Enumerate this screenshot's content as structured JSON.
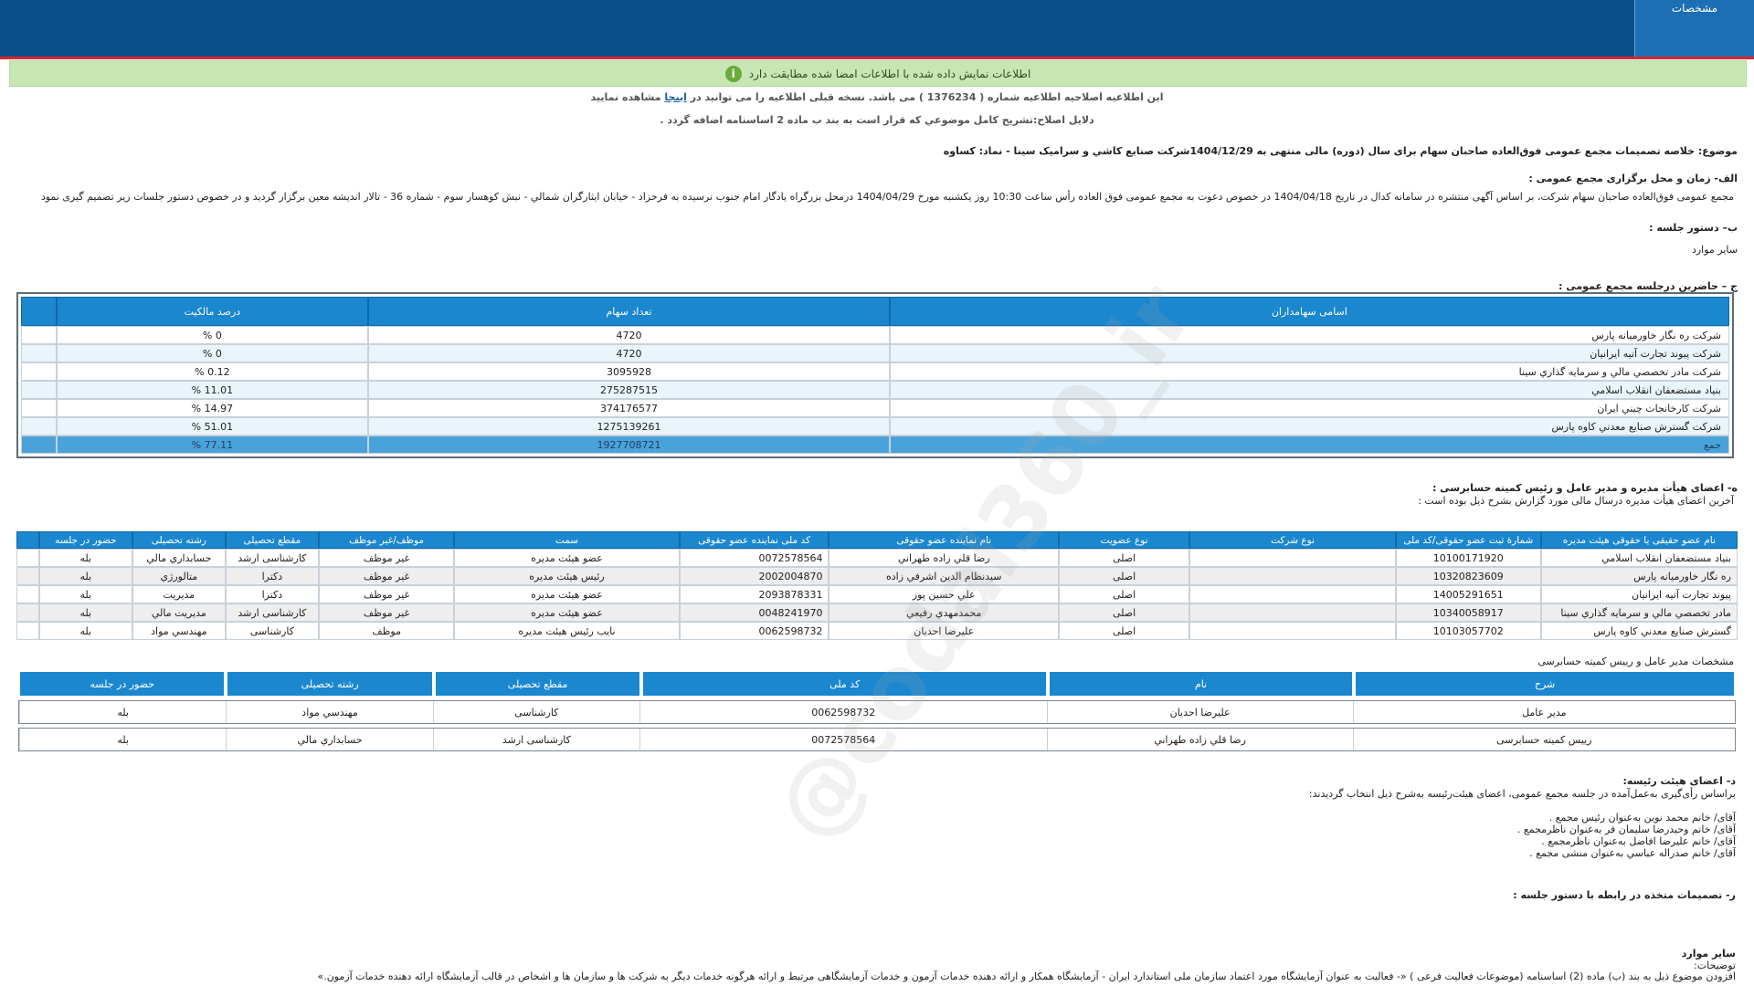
{
  "header": {
    "tab_label": "مشخصات"
  },
  "alert": {
    "text": "اطلاعات نمایش داده شده با اطلاعات امضا شده مطابقت دارد"
  },
  "correction": {
    "line1_a": "این اطلاعیه اصلاحیه اطلاعیه شماره ( 1376234 ) می باشد. نسخه قبلی اطلاعیه را می توانید در",
    "line1_link": "اینجا",
    "line1_b": "مشاهده نمایید",
    "line2": "دلایل اصلاح:تشریح کامل موضوعي که قرار است به بند ب ماده 2 اساسنامه اضافه گردد ."
  },
  "subject": "موضوع: خلاصه تصمیمات مجمع عمومی فوق‌العاده صاحبان سهام برای سال (دوره) مالی منتهی به 1404/12/29شرکت صنايع کاشي و سراميک سينا - نماد: کساوه",
  "section_a": {
    "title": "الف- زمان و محل برگزاری مجمع عمومی :",
    "text": "مجمع عمومی فوق‌العاده صاحبان سهام شرکت، بر اساس آگهی منتشره در سامانه کدال در تاریخ 1404/04/18 در خصوص دعوت به مجمع عمومی فوق العاده رأس ساعت 10:30 روز یکشنبه مورخ 1404/04/29 درمحل بزرگراه يادگار امام جنوب نرسيده به فرحزاد - خيابان ايثارگران شمالي - نبش کوهسار سوم - شماره 36 - تالار انديشه معين   برگزار گردید و در خصوص دستور جلسات زیر تصمیم گیری نمود"
  },
  "section_b": {
    "title": "ب– دستور جلسه :",
    "text": "سایر موارد"
  },
  "section_c": {
    "title": "ج – حاضرین درجلسه مجمع عمومی :",
    "headers": [
      "اسامی سهامداران",
      "تعداد سهام",
      "درصد مالکیت"
    ],
    "rows": [
      [
        "شرکت ره نگار خاورمیانه پارس",
        "4720",
        "0 %"
      ],
      [
        "شرکت پیوند تجارت آتیه ایرانیان",
        "4720",
        "0 %"
      ],
      [
        "شرکت مادر تخصصي مالي و سرمايه گذاري سينا",
        "3095928",
        "0.12 %"
      ],
      [
        "بنياد مستضعفان انقلاب اسلامي",
        "275287515",
        "11.01 %"
      ],
      [
        "شرکت کارخانجات چيني ايران",
        "374176577",
        "14.97 %"
      ],
      [
        "شرکت گسترش صنايع معدني کاوه پارس",
        "1275139261",
        "51.01 %"
      ],
      [
        "جمع",
        "1927708721",
        "77.11 %"
      ]
    ]
  },
  "section_h": {
    "title": "ه- اعضای هیأت مدیره و مدیر عامل و رئیس کمیته حسابرسی :",
    "subtitle": "آخرین اعضای هیأت مدیره درسال مالی مورد گزارش بشرح ذیل بوده است :",
    "headers": [
      "نام عضو حقیقی یا حقوقی هیئت مدیره",
      "شمارهٔ ثبت عضو حقوقی/کد ملی",
      "نوع شرکت",
      "نوع عضویت",
      "نام نماینده عضو حقوقی",
      "کد ملی نماینده عضو حقوقی",
      "سمت",
      "موظف/غیر موظف",
      "مقطع تحصیلی",
      "رشته تحصیلی",
      "حضور در جلسه"
    ],
    "rows": [
      [
        "بنياد مستضعفان انقلاب اسلامي",
        "10100171920",
        "",
        "اصلی",
        "رضا قلي زاده طهراني",
        "0072578564",
        "عضو هیئت مدیره",
        "غیر موظف",
        "کارشناسی ارشد",
        "حسابداري مالي",
        "بله"
      ],
      [
        "ره نگار خاورميانه پارس",
        "10320823609",
        "",
        "اصلی",
        "سيدنظام الدين اشرفي زاده",
        "2002004870",
        "رئیس هیئت مدیره",
        "غیر موظف",
        "دکترا",
        "متالورژي",
        "بله"
      ],
      [
        "پيوند تجارت آتيه ايرانيان",
        "14005291651",
        "",
        "اصلی",
        "علي حسين پور",
        "2093878331",
        "عضو هیئت مدیره",
        "غیر موظف",
        "دکترا",
        "مديريت",
        "بله"
      ],
      [
        "مادر تخصصي مالي و سرمايه گذاري سينا",
        "10340058917",
        "",
        "اصلی",
        "محمدمهدي رفيعي",
        "0048241970",
        "عضو هیئت مدیره",
        "غیر موظف",
        "کارشناسی ارشد",
        "مديريت مالي",
        "بله"
      ],
      [
        "گسترش صنايع معدني کاوه پارس",
        "10103057702",
        "",
        "اصلی",
        "عليرضا احديان",
        "0062598732",
        "نایب رئیس هیئت مدیره",
        "موظف",
        "کارشناسی",
        "مهندسي مواد",
        "بله"
      ]
    ]
  },
  "managers": {
    "title": "مشخصات مدیر عامل و رییس کمیته حسابرسی",
    "headers": [
      "شرح",
      "نام",
      "کد ملی",
      "مقطع تحصیلی",
      "رشته تحصیلی",
      "حضور در جلسه"
    ],
    "rows": [
      [
        "مدیر عامل",
        "عليرضا احديان",
        "0062598732",
        "کارشناسی",
        "مهندسي مواد",
        "بله"
      ],
      [
        "رییس کمیته حسابرسی",
        "رضا قلي زاده طهراني",
        "0072578564",
        "کارشناسی ارشد",
        "حسابداري مالي",
        "بله"
      ]
    ]
  },
  "section_d": {
    "title": "د- اعضای هیئت رئیسه:",
    "intro": "براساس رأی‌گیری به‌عمل‌آمده در جلسه مجمع عمومی، اعضای هیئت‌رئیسه به‌شرح ذیل انتخاب گردیدند:",
    "members": [
      "آقای/ خانم  محمد نوين  به‌عنوان رئیس مجمع .",
      "آقای/ خانم  وحيدرضا سليمان فر  به‌عنوان ناظرمجمع .",
      "آقای/ خانم  عليرضا افاضل  به‌عنوان ناظرمجمع .",
      "آقای/ خانم  صدراله عباسي  به‌عنوان منشی مجمع ."
    ]
  },
  "section_r": {
    "title": "ر- تصمیمات متخذه در رابطه با دستور جلسه :",
    "other_title": "سایر موارد",
    "notes_label": "توضیحات:",
    "notes_text": "افزودن موضوع ذیل به بند (ب) ماده (2) اساسنامه (موضوعات فعالیت فرعی ) «- فعالیت به عنوان آزمایشگاه مورد اعتماد سازمان ملی استاندارد ایران - آزمایشگاه همکار و ارائه دهنده خدمات آزمون و خدمات آزمایشگاهی مرتبط و ارائه هرگونه خدمات دیگر به شرکت ها و سازمان ها و اشخاص در قالب آزمایشگاه ارائه دهنده خدمات آزمون.»"
  },
  "watermark": "@codal360_ir"
}
